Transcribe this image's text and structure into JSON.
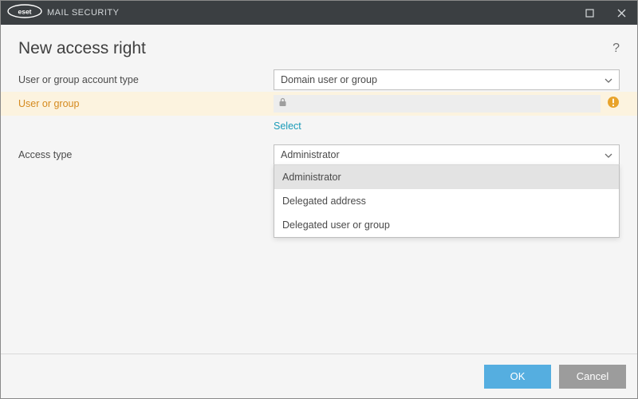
{
  "titlebar": {
    "app_name": "MAIL SECURITY",
    "brand_word": "eset"
  },
  "page": {
    "title": "New access right"
  },
  "form": {
    "accountTypeLabel": "User or group account type",
    "accountTypeValue": "Domain user or group",
    "userGroupLabel": "User or group",
    "selectLink": "Select",
    "accessTypeLabel": "Access type",
    "accessTypeValue": "Administrator",
    "accessTypeOptions": [
      "Administrator",
      "Delegated address",
      "Delegated user or group"
    ]
  },
  "buttons": {
    "ok": "OK",
    "cancel": "Cancel"
  },
  "colors": {
    "accent": "#55aee0",
    "warnBg": "#fcf3df",
    "warnText": "#d58a1e",
    "link": "#1a9bb8"
  }
}
